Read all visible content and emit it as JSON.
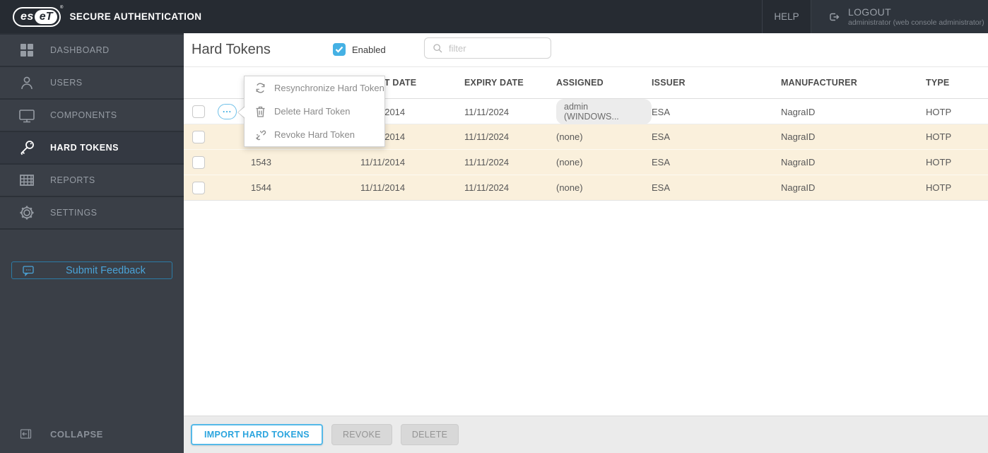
{
  "topbar": {
    "brand_left": "es",
    "brand_right": "eT",
    "product": "SECURE AUTHENTICATION",
    "help_label": "HELP",
    "logout_label": "LOGOUT",
    "logout_sub": "administrator (web console administrator)"
  },
  "sidebar": {
    "items": [
      {
        "label": "DASHBOARD",
        "icon": "dashboard-icon",
        "active": false
      },
      {
        "label": "USERS",
        "icon": "users-icon",
        "active": false
      },
      {
        "label": "COMPONENTS",
        "icon": "components-icon",
        "active": false
      },
      {
        "label": "HARD TOKENS",
        "icon": "hard-tokens-key-icon",
        "active": true
      },
      {
        "label": "REPORTS",
        "icon": "reports-icon",
        "active": false
      },
      {
        "label": "SETTINGS",
        "icon": "settings-icon",
        "active": false
      }
    ],
    "feedback_label": "Submit Feedback",
    "collapse_label": "COLLAPSE"
  },
  "header": {
    "title": "Hard Tokens",
    "enabled_label": "Enabled",
    "enabled_checked": true,
    "filter_placeholder": "filter"
  },
  "table": {
    "headers": {
      "start_date": "START DATE",
      "expiry_date": "EXPIRY DATE",
      "assigned": "ASSIGNED",
      "issuer": "ISSUER",
      "manufacturer": "MANUFACTURER",
      "type": "TYPE"
    },
    "rows": [
      {
        "serial": "",
        "start_date": "11/11/2014",
        "expiry_date": "11/11/2024",
        "assigned": "admin (WINDOWS...",
        "assigned_is_badge": true,
        "issuer": "ESA",
        "manufacturer": "NagraID",
        "type": "HOTP",
        "highlight": false
      },
      {
        "serial": "",
        "start_date": "11/11/2014",
        "expiry_date": "11/11/2024",
        "assigned": "(none)",
        "assigned_is_badge": false,
        "issuer": "ESA",
        "manufacturer": "NagraID",
        "type": "HOTP",
        "highlight": true
      },
      {
        "serial": "1543",
        "start_date": "11/11/2014",
        "expiry_date": "11/11/2024",
        "assigned": "(none)",
        "assigned_is_badge": false,
        "issuer": "ESA",
        "manufacturer": "NagraID",
        "type": "HOTP",
        "highlight": true
      },
      {
        "serial": "1544",
        "start_date": "11/11/2014",
        "expiry_date": "11/11/2024",
        "assigned": "(none)",
        "assigned_is_badge": false,
        "issuer": "ESA",
        "manufacturer": "NagraID",
        "type": "HOTP",
        "highlight": true
      }
    ],
    "actions_button": "..."
  },
  "context_menu": {
    "items": [
      {
        "label": "Resynchronize Hard Token",
        "icon": "resync-icon"
      },
      {
        "label": "Delete Hard Token",
        "icon": "trash-icon"
      },
      {
        "label": "Revoke Hard Token",
        "icon": "revoke-icon"
      }
    ]
  },
  "footer": {
    "import_label": "IMPORT HARD TOKENS",
    "revoke_label": "REVOKE",
    "delete_label": "DELETE"
  },
  "colors": {
    "accent_blue": "#2fa7e0",
    "checkbox_blue": "#45b1e4",
    "topbar_bg": "#262b32",
    "sidebar_bg": "#3a3f47",
    "highlight_row": "#faf0dc",
    "footer_bg": "#ebebeb"
  }
}
